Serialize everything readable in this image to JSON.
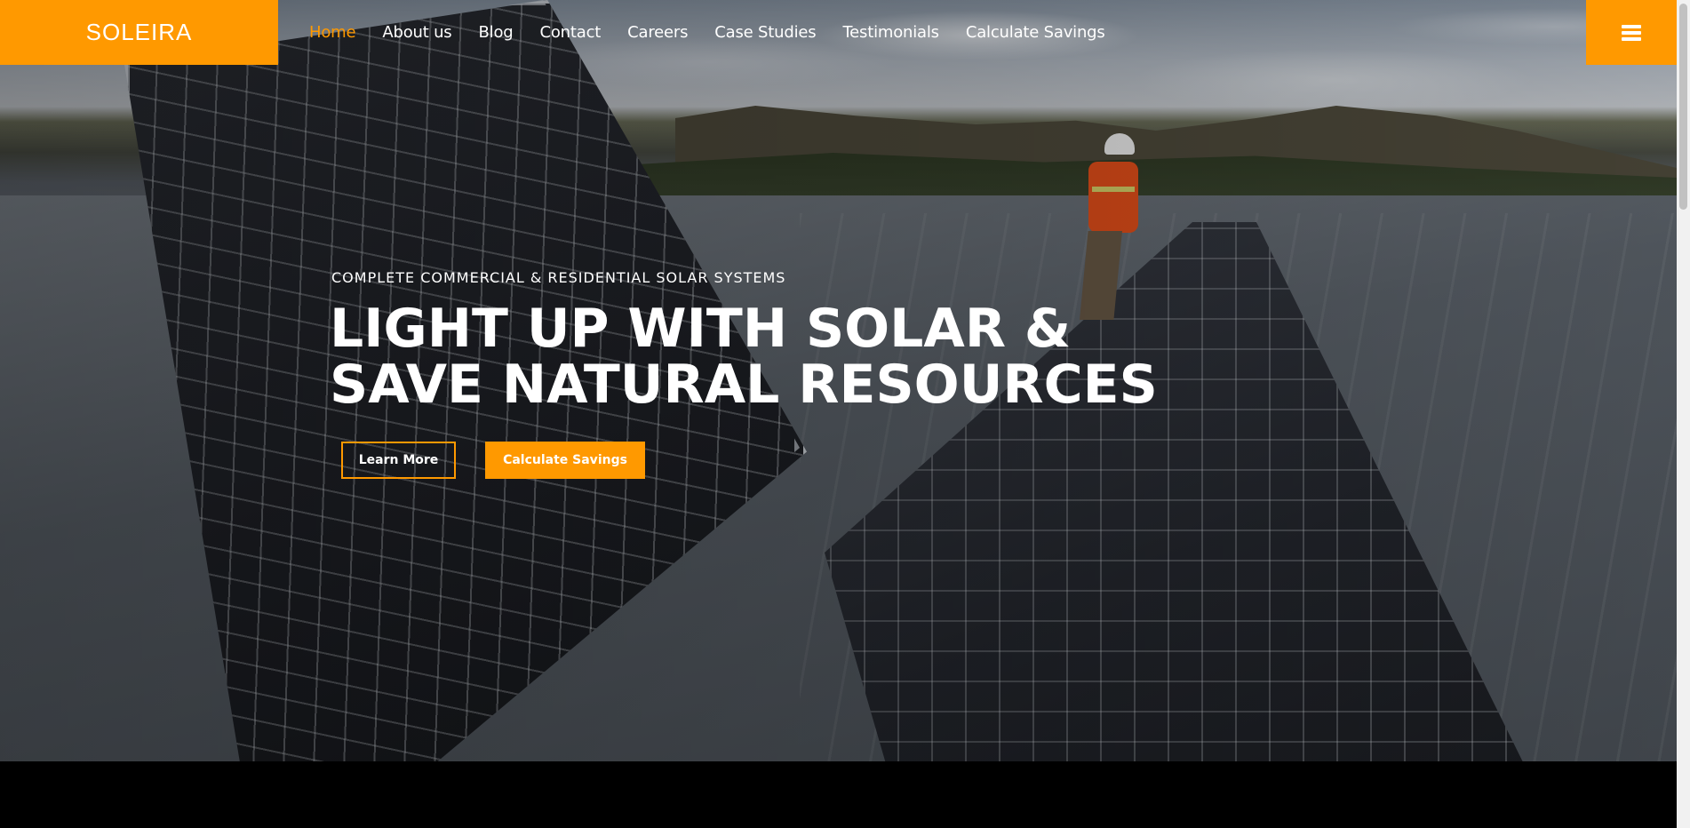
{
  "brand": {
    "logo_text": "SOLEIRA",
    "accent_color": "#ff9900"
  },
  "nav": {
    "items": [
      {
        "label": "Home",
        "active": true
      },
      {
        "label": "About us"
      },
      {
        "label": "Blog"
      },
      {
        "label": "Contact"
      },
      {
        "label": "Careers"
      },
      {
        "label": "Case Studies"
      },
      {
        "label": "Testimonials"
      },
      {
        "label": "Calculate Savings"
      }
    ],
    "menu_icon": "hamburger-icon"
  },
  "hero": {
    "eyebrow": "COMPLETE COMMERCIAL & RESIDENTIAL SOLAR SYSTEMS",
    "headline_line1": "LIGHT UP WITH SOLAR &",
    "headline_line2": "SAVE NATURAL RESOURCES",
    "buttons": {
      "learn_more": "Learn More",
      "calculate": "Calculate Savings"
    }
  }
}
